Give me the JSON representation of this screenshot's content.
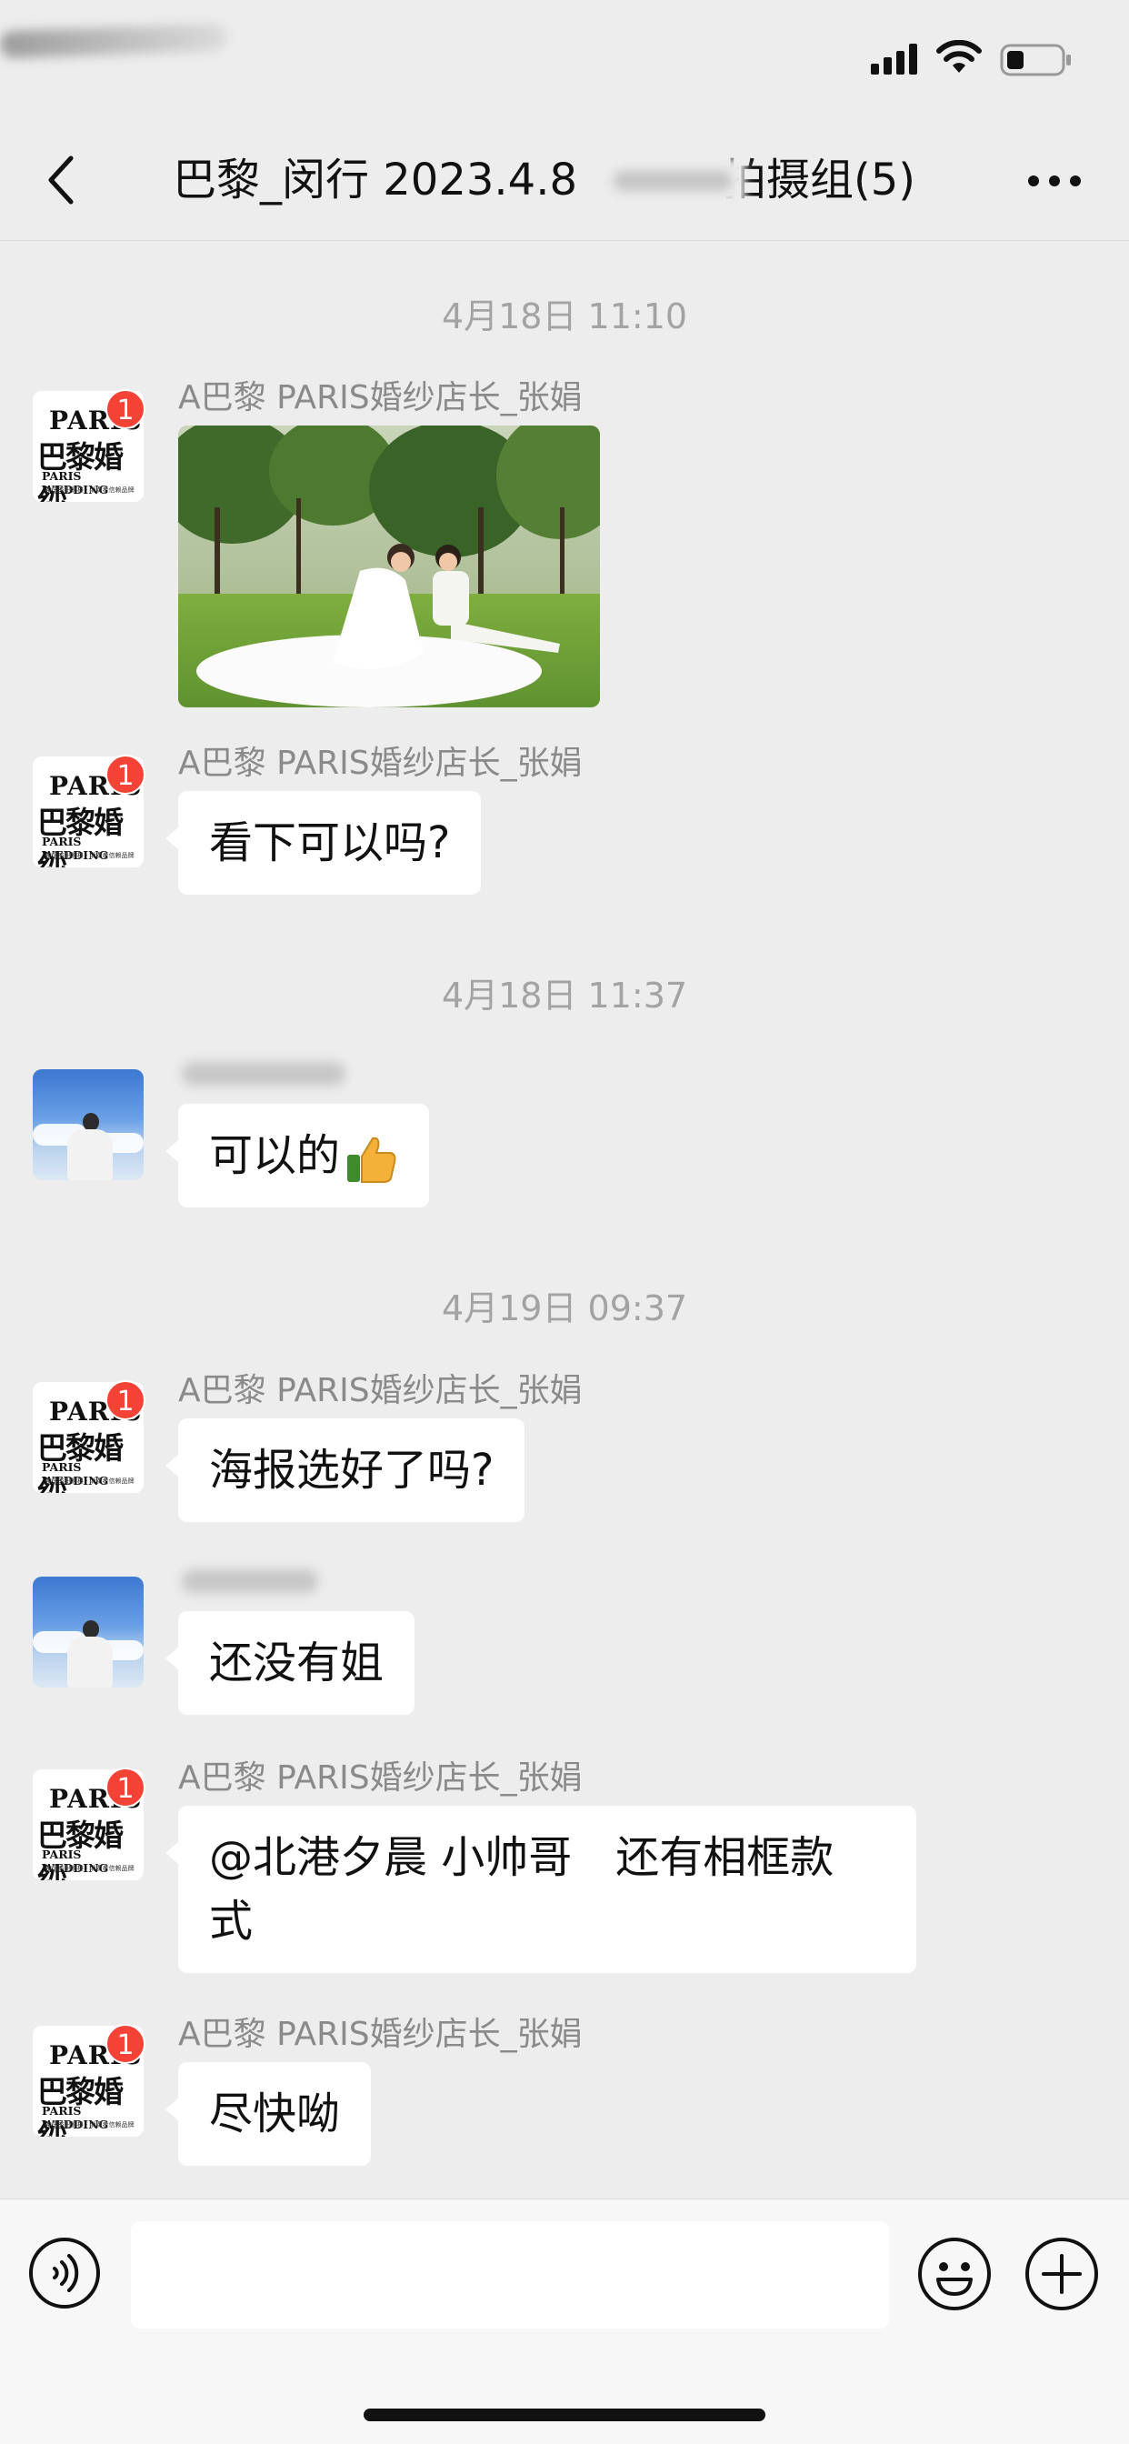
{
  "header": {
    "title_left": "巴黎_闵行 2023.4.8",
    "title_right": "拍摄组(5)",
    "back_icon": "chevron-left-icon",
    "more_icon": "more-dots-icon"
  },
  "messages": {
    "time1": "4月18日 11:10",
    "msg1": {
      "sender": "A巴黎 PARIS婚纱店长_张娟",
      "type": "image",
      "badge": "1"
    },
    "msg2": {
      "sender": "A巴黎 PARIS婚纱店长_张娟",
      "text": "看下可以吗?",
      "badge": "1"
    },
    "time2": "4月18日 11:37",
    "msg3": {
      "text": "可以的"
    },
    "time3": "4月19日 09:37",
    "msg4": {
      "sender": "A巴黎 PARIS婚纱店长_张娟",
      "text": "海报选好了吗?",
      "badge": "1"
    },
    "msg5": {
      "text": "还没有姐"
    },
    "msg6": {
      "sender": "A巴黎 PARIS婚纱店长_张娟",
      "line1": "@北港夕晨 小帅哥　还有相框款",
      "line2": "式",
      "badge": "1"
    },
    "msg7": {
      "sender": "A巴黎 PARIS婚纱店长_张娟",
      "text": "尽快呦",
      "badge": "1"
    }
  },
  "avatar_brand": {
    "line1": "PARIS",
    "line2": "巴黎婚纱",
    "line3": "PARIS WEDDING",
    "line4": "中国杰出影楼 · 消费者信赖品牌"
  },
  "input": {
    "value": "",
    "voice_icon": "voice-icon",
    "emoji_icon": "emoji-icon",
    "plus_icon": "plus-icon"
  }
}
